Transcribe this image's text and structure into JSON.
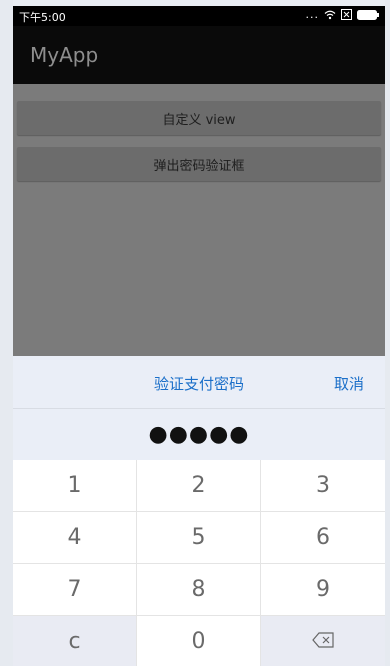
{
  "status_bar": {
    "time": "下午5:00",
    "dots": "...",
    "wifi_icon": "wifi-icon",
    "sim_icon": "sim-icon",
    "battery_icon": "battery-icon"
  },
  "app": {
    "title": "MyApp"
  },
  "buttons": {
    "custom_view": "自定义 view",
    "show_password_dialog": "弹出密码验证框"
  },
  "dialog": {
    "title": "验证支付密码",
    "cancel": "取消",
    "password_mask": "●●●●●",
    "digits_entered": 5
  },
  "keypad": {
    "keys": [
      "1",
      "2",
      "3",
      "4",
      "5",
      "6",
      "7",
      "8",
      "9",
      "c",
      "0"
    ],
    "backspace_icon": "backspace-icon"
  },
  "colors": {
    "accent": "#1b6fc9",
    "statusbar": "#000000",
    "actionbar": "#0a0a0a",
    "overlay_content": "#7b7b7b",
    "sheet_background": "#eaeef7"
  }
}
